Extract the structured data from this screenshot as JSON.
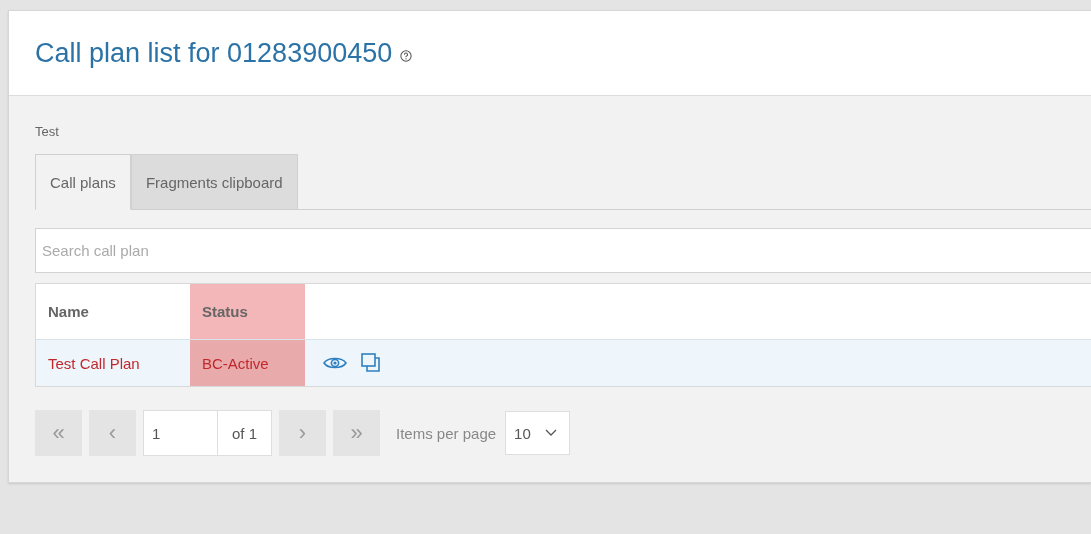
{
  "page": {
    "title": "Call plan list for 01283900450",
    "subtitle": "Test"
  },
  "tabs": [
    {
      "label": "Call plans",
      "selected": true
    },
    {
      "label": "Fragments clipboard",
      "selected": false
    }
  ],
  "search": {
    "placeholder": "Search call plan"
  },
  "table": {
    "columns": [
      {
        "label": "Name",
        "highlighted": false
      },
      {
        "label": "Status",
        "highlighted": true
      }
    ],
    "rows": [
      {
        "cells": [
          "Test Call Plan",
          "BC-Active"
        ]
      }
    ]
  },
  "pagination": {
    "nav_before": [
      {
        "label": "«",
        "disabled": true
      },
      {
        "label": "‹",
        "disabled": true
      }
    ],
    "page": "1",
    "of": "of 1",
    "nav_after": [
      {
        "label": "›",
        "disabled": true
      },
      {
        "label": "»",
        "disabled": true
      }
    ],
    "items_label": "Items per page",
    "page_size": "10"
  }
}
